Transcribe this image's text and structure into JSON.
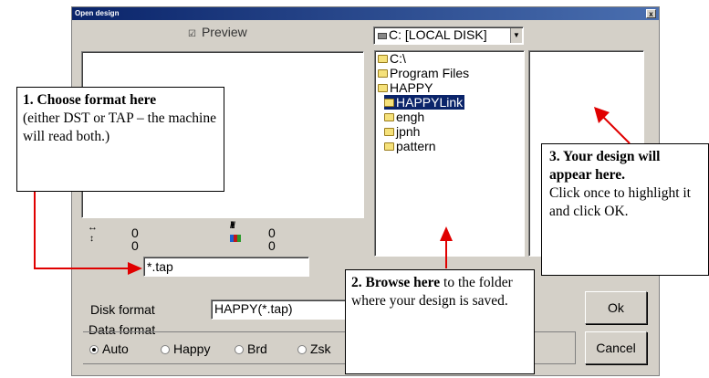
{
  "window": {
    "title": "Open design",
    "close_label": "x"
  },
  "preview": {
    "label": "Preview",
    "checkbox": "☑"
  },
  "drive": {
    "value": "C: [LOCAL DISK]"
  },
  "tree": {
    "items": [
      {
        "label": "C:\\"
      },
      {
        "label": "Program Files"
      },
      {
        "label": "HAPPY"
      },
      {
        "label": "HAPPYLink"
      },
      {
        "label": "engh"
      },
      {
        "label": "jpnh"
      },
      {
        "label": "pattern"
      }
    ]
  },
  "stats": {
    "width": "0",
    "height": "0",
    "stitches": "0",
    "colors": "0"
  },
  "filter": {
    "value": "*.tap"
  },
  "disk_format": {
    "label": "Disk format",
    "value": "HAPPY(*.tap)"
  },
  "data_format": {
    "label": "Data format",
    "options": [
      {
        "label": "Auto",
        "selected": true
      },
      {
        "label": "Happy",
        "selected": false
      },
      {
        "label": "Brd",
        "selected": false
      },
      {
        "label": "Zsk",
        "selected": false
      }
    ]
  },
  "buttons": {
    "ok": "Ok",
    "cancel": "Cancel"
  },
  "callouts": {
    "one": {
      "title": "1.  Choose format here",
      "body": "(either DST or TAP – the machine will read both.)"
    },
    "two": {
      "title": "2.  Browse here",
      "body": " to the folder where your design is saved."
    },
    "three": {
      "title": "3.  Your design will appear here.",
      "body": "Click once to highlight it and click OK."
    }
  },
  "colors": {
    "selection": "#0a246a",
    "arrow": "#e00000"
  }
}
